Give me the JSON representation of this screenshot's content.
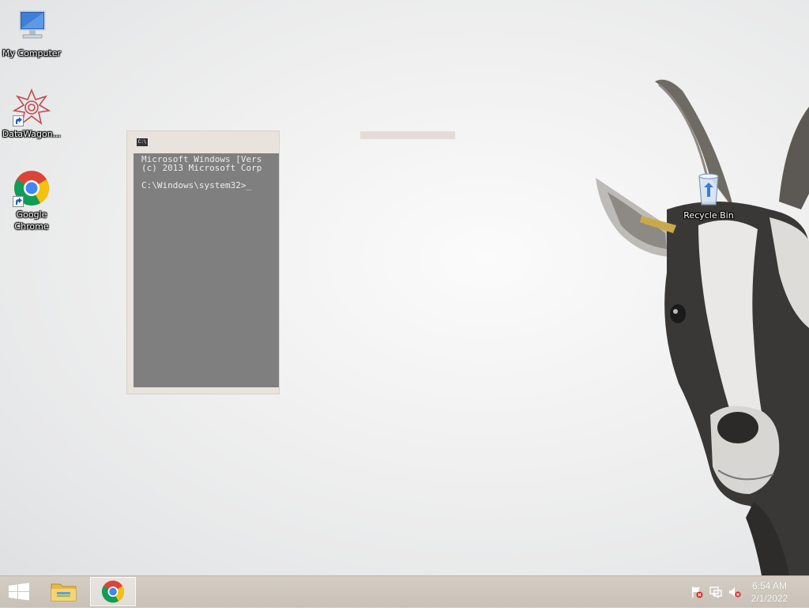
{
  "desktop": {
    "icons": [
      {
        "label": "My Computer",
        "icon": "computer-icon"
      },
      {
        "label": "DataWagon...",
        "icon": "datawagon-icon"
      },
      {
        "label": "Google Chrome",
        "icon": "chrome-icon"
      },
      {
        "label": "Recycle Bin",
        "icon": "recycle-bin-icon"
      }
    ]
  },
  "cmd_window": {
    "title_icon_text": "C:\\",
    "lines": "Microsoft Windows [Vers\n(c) 2013 Microsoft Corp\n\nC:\\Windows\\system32>_"
  },
  "taskbar": {
    "start_icon": "windows-logo-icon",
    "pinned": [
      {
        "name": "File Explorer",
        "icon": "folder-icon",
        "active": false
      },
      {
        "name": "Google Chrome",
        "icon": "chrome-icon",
        "active": true
      }
    ],
    "tray_icons": [
      "action-center-flag-icon",
      "network-icon",
      "volume-muted-icon"
    ],
    "clock": {
      "time": "6:54 AM",
      "date": "2/1/2022"
    }
  },
  "colors": {
    "cmd_background": "#7f7f7f",
    "taskbar": "#cfc7bd"
  }
}
